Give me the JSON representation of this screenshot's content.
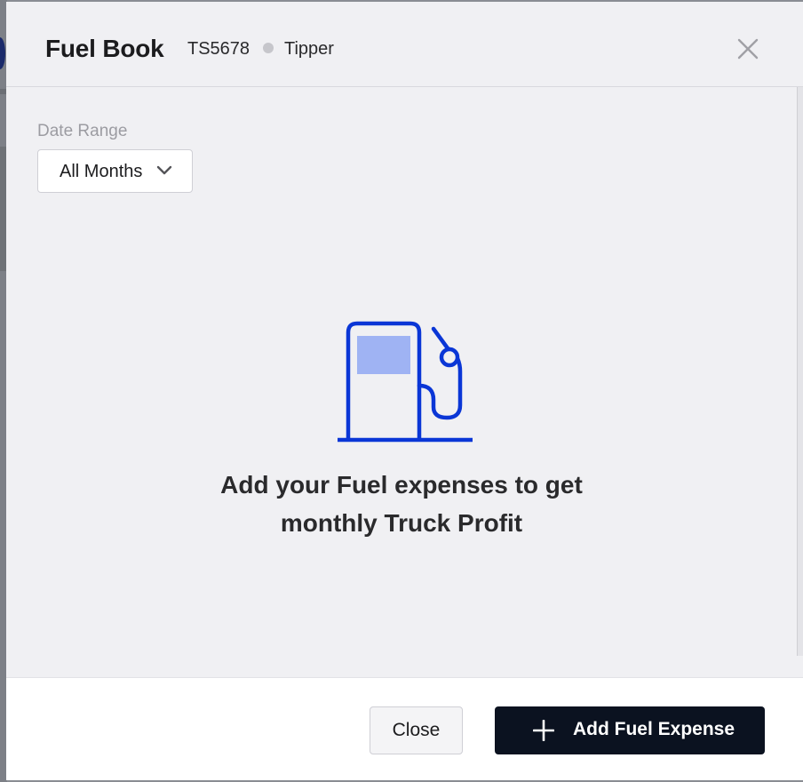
{
  "header": {
    "title": "Fuel Book",
    "vehicle_number": "TS5678",
    "vehicle_type": "Tipper"
  },
  "filters": {
    "date_range_label": "Date Range",
    "date_range_value": "All Months"
  },
  "empty_state": {
    "icon": "fuel-pump-icon",
    "line1": "Add your Fuel expenses to get",
    "line2": "monthly Truck Profit"
  },
  "footer": {
    "close_label": "Close",
    "add_label": "Add Fuel Expense"
  },
  "colors": {
    "accent_blue": "#0a36d6",
    "icon_fill_light": "#9fb3f3",
    "primary_button": "#0b1220"
  }
}
